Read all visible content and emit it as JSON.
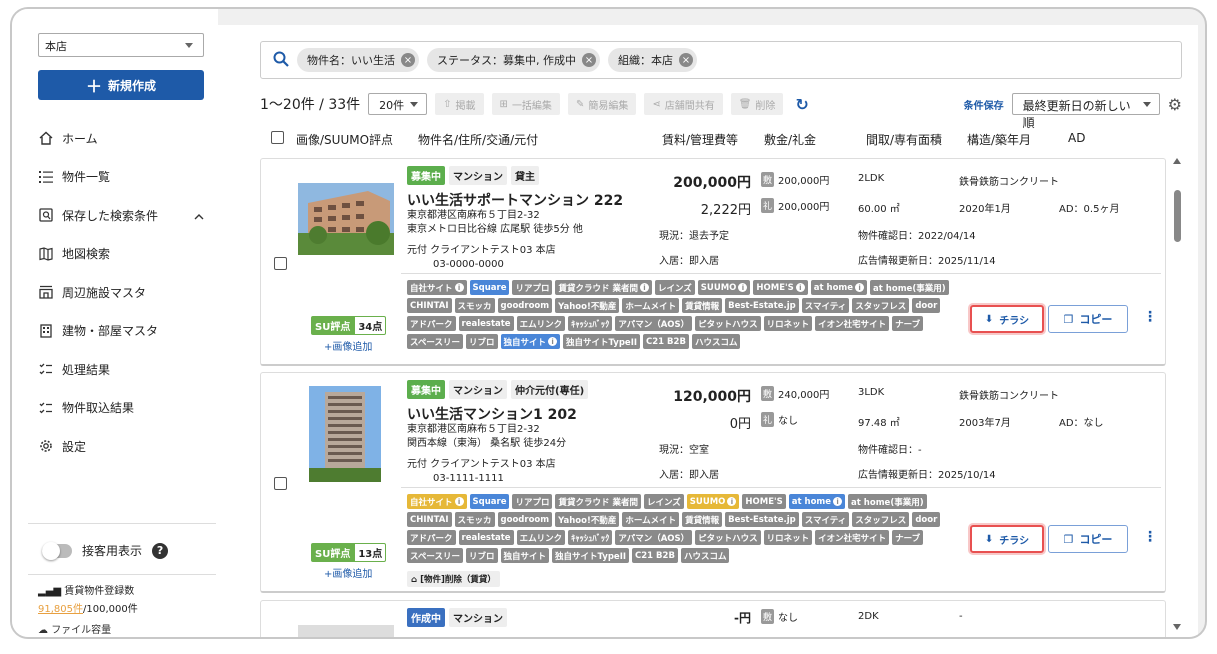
{
  "sidebar": {
    "store": "本店",
    "new_button": "新規作成",
    "items": [
      {
        "label": "ホーム"
      },
      {
        "label": "物件一覧"
      },
      {
        "label": "保存した検索条件"
      },
      {
        "label": "地図検索"
      },
      {
        "label": "周辺施設マスタ"
      },
      {
        "label": "建物・部屋マスタ"
      },
      {
        "label": "処理結果"
      },
      {
        "label": "物件取込結果"
      },
      {
        "label": "設定"
      }
    ],
    "customer_view": "接客用表示",
    "count_label": "賃貸物件登録数",
    "count_value": "91,805件",
    "count_limit": "/100,000件",
    "cut_text": "ファイル容量"
  },
  "search": {
    "chips": [
      "物件名：いい生活",
      "ステータス：募集中, 作成中",
      "組織：本店"
    ]
  },
  "toolbar": {
    "range": "1〜20件 / 33件",
    "per_page": "20件",
    "buttons": [
      "掲載",
      "一括編集",
      "簡易編集",
      "店舗間共有",
      "削除"
    ],
    "save_condition": "条件保存",
    "sort": "最終更新日の新しい順"
  },
  "columns": {
    "photo": "画像/SUUMO評点",
    "name": "物件名/住所/交通/元付",
    "rent": "賃料/管理費等",
    "deposit": "敷金/礼金",
    "layout": "間取/専有面積",
    "structure": "構造/築年月",
    "ad": "AD"
  },
  "cards": [
    {
      "badges": [
        "募集中",
        "マンション",
        "貸主"
      ],
      "name": "いい生活サポートマンション 222",
      "address": "東京都港区南麻布５丁目2-32",
      "station": "東京メトロ日比谷線 広尾駅 徒歩5分 他",
      "motozuke": "元付 クライアントテスト03 本店",
      "phone": "03-0000-0000",
      "rent": "200,000円",
      "mgmt": "2,222円",
      "deposit_k": "敷",
      "deposit": "200,000円",
      "key_k": "礼",
      "key_money": "200,000円",
      "layout": "2LDK",
      "area": "60.00 ㎡",
      "structure": "鉄骨鉄筋コンクリート",
      "built": "2020年1月",
      "ad": "AD：0.5ヶ月",
      "status": "現況：退去予定",
      "move_in": "入居：即入居",
      "confirmed": "物件確認日：2022/04/14",
      "ad_updated": "広告情報更新日：2025/11/14",
      "su_label": "SU評点",
      "su_score": "34点",
      "add_image": "+画像追加",
      "tags": [
        {
          "t": "自社サイト",
          "c": "gray",
          "i": true
        },
        {
          "t": "Square",
          "c": "blue"
        },
        {
          "t": "リアプロ",
          "c": "gray"
        },
        {
          "t": "賃貸クラウド 業者間",
          "c": "gray",
          "i": true
        },
        {
          "t": "レインズ",
          "c": "gray"
        },
        {
          "t": "SUUMO",
          "c": "gray",
          "i": true
        },
        {
          "t": "HOME'S",
          "c": "gray",
          "i": true
        },
        {
          "t": "at home",
          "c": "gray",
          "i": true
        },
        {
          "t": "at home(事業用)",
          "c": "gray"
        },
        {
          "t": "CHINTAI",
          "c": "gray"
        },
        {
          "t": "スモッカ",
          "c": "gray"
        },
        {
          "t": "goodroom",
          "c": "gray"
        },
        {
          "t": "Yahoo!不動産",
          "c": "gray"
        },
        {
          "t": "ホームメイト",
          "c": "gray"
        },
        {
          "t": "賃貸情報",
          "c": "gray"
        },
        {
          "t": "Best-Estate.jp",
          "c": "gray"
        },
        {
          "t": "スマイティ",
          "c": "gray"
        },
        {
          "t": "スタッフレス",
          "c": "gray"
        },
        {
          "t": "door",
          "c": "gray"
        },
        {
          "t": "アドパーク",
          "c": "gray"
        },
        {
          "t": "realestate",
          "c": "gray"
        },
        {
          "t": "エムリンク",
          "c": "gray"
        },
        {
          "t": "ｷｬｯｼｭﾊﾞｯｸ",
          "c": "gray"
        },
        {
          "t": "アパマン（AOS）",
          "c": "gray"
        },
        {
          "t": "ピタットハウス",
          "c": "gray"
        },
        {
          "t": "リロネット",
          "c": "gray"
        },
        {
          "t": "イオン社宅サイト",
          "c": "gray"
        },
        {
          "t": "ナーブ",
          "c": "gray"
        },
        {
          "t": "スペースリー",
          "c": "gray"
        },
        {
          "t": "リブロ",
          "c": "gray"
        },
        {
          "t": "独自サイト",
          "c": "blue",
          "i": true
        },
        {
          "t": "独自サイトTypeII",
          "c": "gray"
        },
        {
          "t": "C21 B2B",
          "c": "gray"
        },
        {
          "t": "ハウスコム",
          "c": "gray"
        }
      ],
      "flyer": "チラシ",
      "copy": "コピー"
    },
    {
      "badges": [
        "募集中",
        "マンション",
        "仲介元付(専任)"
      ],
      "name": "いい生活マンション1 202",
      "address": "東京都港区南麻布５丁目2-32",
      "station": "関西本線（東海） 桑名駅 徒歩24分",
      "motozuke": "元付 クライアントテスト03 本店",
      "phone": "03-1111-1111",
      "rent": "120,000円",
      "mgmt": "0円",
      "deposit_k": "敷",
      "deposit": "240,000円",
      "key_k": "礼",
      "key_money": "なし",
      "layout": "3LDK",
      "area": "97.48 ㎡",
      "structure": "鉄骨鉄筋コンクリート",
      "built": "2003年7月",
      "ad": "AD：なし",
      "status": "現況：空室",
      "move_in": "入居：即入居",
      "confirmed": "物件確認日：-",
      "ad_updated": "広告情報更新日：2025/10/14",
      "su_label": "SU評点",
      "su_score": "13点",
      "add_image": "+画像追加",
      "memo": "[物件]削除（賃貸）",
      "tags": [
        {
          "t": "自社サイト",
          "c": "yellow",
          "i": true
        },
        {
          "t": "Square",
          "c": "blue"
        },
        {
          "t": "リアプロ",
          "c": "gray"
        },
        {
          "t": "賃貸クラウド 業者間",
          "c": "gray"
        },
        {
          "t": "レインズ",
          "c": "gray"
        },
        {
          "t": "SUUMO",
          "c": "yellow",
          "i": true
        },
        {
          "t": "HOME'S",
          "c": "gray"
        },
        {
          "t": "at home",
          "c": "blue",
          "i": true
        },
        {
          "t": "at home(事業用)",
          "c": "gray"
        },
        {
          "t": "CHINTAI",
          "c": "gray"
        },
        {
          "t": "スモッカ",
          "c": "gray"
        },
        {
          "t": "goodroom",
          "c": "gray"
        },
        {
          "t": "Yahoo!不動産",
          "c": "gray"
        },
        {
          "t": "ホームメイト",
          "c": "gray"
        },
        {
          "t": "賃貸情報",
          "c": "gray"
        },
        {
          "t": "Best-Estate.jp",
          "c": "gray"
        },
        {
          "t": "スマイティ",
          "c": "gray"
        },
        {
          "t": "スタッフレス",
          "c": "gray"
        },
        {
          "t": "door",
          "c": "gray"
        },
        {
          "t": "アドパーク",
          "c": "gray"
        },
        {
          "t": "realestate",
          "c": "gray"
        },
        {
          "t": "エムリンク",
          "c": "gray"
        },
        {
          "t": "ｷｬｯｼｭﾊﾞｯｸ",
          "c": "gray"
        },
        {
          "t": "アパマン（AOS）",
          "c": "gray"
        },
        {
          "t": "ピタットハウス",
          "c": "gray"
        },
        {
          "t": "リロネット",
          "c": "gray"
        },
        {
          "t": "イオン社宅サイト",
          "c": "gray"
        },
        {
          "t": "ナーブ",
          "c": "gray"
        },
        {
          "t": "スペースリー",
          "c": "gray"
        },
        {
          "t": "リブロ",
          "c": "gray"
        },
        {
          "t": "独自サイト",
          "c": "gray"
        },
        {
          "t": "独自サイトTypeII",
          "c": "gray"
        },
        {
          "t": "C21 B2B",
          "c": "gray"
        },
        {
          "t": "ハウスコム",
          "c": "gray"
        }
      ],
      "flyer": "チラシ",
      "copy": "コピー"
    },
    {
      "badges": [
        "作成中",
        "マンション"
      ],
      "rent": "-円",
      "deposit_k": "敷",
      "deposit": "なし",
      "layout": "2DK",
      "structure": "-"
    }
  ],
  "colors": {
    "accent": "#1e5aa8",
    "recruiting": "#5cae4d",
    "creating": "#3a70c0",
    "highlight": "#e85050"
  }
}
